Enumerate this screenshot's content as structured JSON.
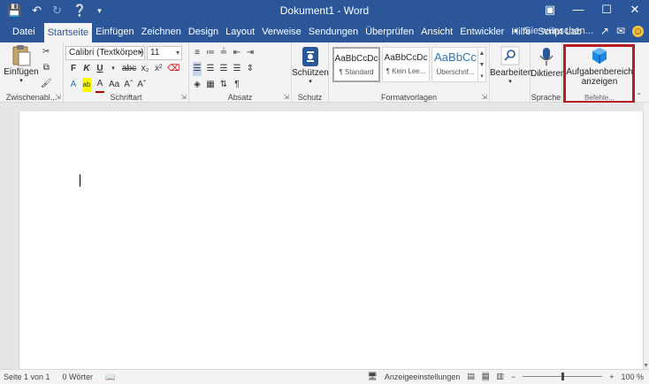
{
  "window": {
    "title": "Dokument1 - Word",
    "qat_icons": [
      "save-icon",
      "undo-icon",
      "redo-icon",
      "touch-mode-icon",
      "customize-qat-icon"
    ]
  },
  "tabs": [
    "Datei",
    "Startseite",
    "Einfügen",
    "Zeichnen",
    "Design",
    "Layout",
    "Verweise",
    "Sendungen",
    "Überprüfen",
    "Ansicht",
    "Entwickler",
    "Hilfe",
    "Script Lab"
  ],
  "active_tab": "Startseite",
  "tell_me": "Sie wünschen...",
  "ribbon": {
    "clipboard": {
      "paste_label": "Einfügen",
      "group_label": "Zwischenabl..."
    },
    "font": {
      "font_name": "Calibri (Textkörper)",
      "font_size": "11",
      "group_label": "Schriftart",
      "bold": "F",
      "italic": "K",
      "underline": "U",
      "strike": "abc"
    },
    "paragraph": {
      "group_label": "Absatz"
    },
    "protect": {
      "label": "Schützen",
      "group_label": "Schutz"
    },
    "styles": {
      "group_label": "Formatvorlagen",
      "items": [
        {
          "preview": "AaBbCcDc",
          "name": "¶ Standard"
        },
        {
          "preview": "AaBbCcDc",
          "name": "¶ Kein Lee..."
        },
        {
          "preview": "AaBbCc",
          "name": "Überschrif..."
        }
      ]
    },
    "editing": {
      "label": "Bearbeiten"
    },
    "voice": {
      "label": "Diktieren",
      "group_label": "Sprache"
    },
    "addin": {
      "label_line1": "Aufgabenbereich",
      "label_line2": "anzeigen",
      "group_label": "Befehle..."
    }
  },
  "status": {
    "page": "Seite 1 von 1",
    "words": "0 Wörter",
    "display_settings": "Anzeigeeinstellungen",
    "zoom": "100 %"
  },
  "colors": {
    "brand": "#2b579a",
    "highlight": "#b11e23",
    "ribbon_bg": "#f3f3f3"
  }
}
